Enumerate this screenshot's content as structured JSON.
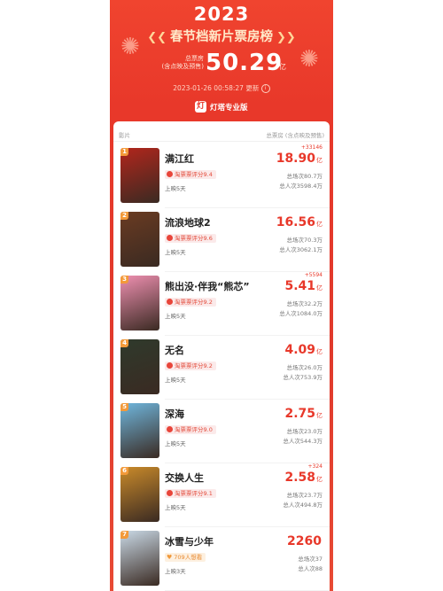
{
  "header": {
    "year": "2023",
    "title": "春节档新片票房榜",
    "total_label_line1": "总票房",
    "total_label_line2": "(含点映及预售)",
    "total_value": "50.29",
    "total_unit": "亿",
    "update_time": "2023-01-26 00:58:27 更新",
    "brand": "灯塔专业版"
  },
  "table": {
    "col_film": "影片",
    "col_box": "总票房 (含点映及预售)"
  },
  "films": [
    {
      "rank": "1",
      "name": "满江红",
      "badge_type": "rating",
      "badge": "淘票票评分9.4",
      "days": "上映5天",
      "delta": "+33146",
      "box": "18.90",
      "unit": "亿",
      "sessions": "总场次80.7万",
      "people": "总人次3598.4万",
      "poster_color": "#b2261c"
    },
    {
      "rank": "2",
      "name": "流浪地球2",
      "badge_type": "rating",
      "badge": "淘票票评分9.6",
      "days": "上映5天",
      "delta": "",
      "box": "16.56",
      "unit": "亿",
      "sessions": "总场次70.3万",
      "people": "总人次3062.1万",
      "poster_color": "#6a3b22"
    },
    {
      "rank": "3",
      "name": "熊出没·伴我“熊芯”",
      "badge_type": "rating",
      "badge": "淘票票评分9.2",
      "days": "上映5天",
      "delta": "+5594",
      "box": "5.41",
      "unit": "亿",
      "sessions": "总场次32.2万",
      "people": "总人次1084.0万",
      "poster_color": "#ee8fb0"
    },
    {
      "rank": "4",
      "name": "无名",
      "badge_type": "rating",
      "badge": "淘票票评分9.2",
      "days": "上映5天",
      "delta": "",
      "box": "4.09",
      "unit": "亿",
      "sessions": "总场次26.0万",
      "people": "总人次753.9万",
      "poster_color": "#2f3a2c"
    },
    {
      "rank": "5",
      "name": "深海",
      "badge_type": "rating",
      "badge": "淘票票评分9.0",
      "days": "上映5天",
      "delta": "",
      "box": "2.75",
      "unit": "亿",
      "sessions": "总场次23.0万",
      "people": "总人次544.3万",
      "poster_color": "#6fb6dd"
    },
    {
      "rank": "6",
      "name": "交换人生",
      "badge_type": "rating",
      "badge": "淘票票评分9.1",
      "days": "上映5天",
      "delta": "+324",
      "box": "2.58",
      "unit": "亿",
      "sessions": "总场次23.7万",
      "people": "总人次494.8万",
      "poster_color": "#c98a2a"
    },
    {
      "rank": "7",
      "name": "冰雪与少年",
      "badge_type": "want",
      "badge": "709人想看",
      "days": "上映3天",
      "delta": "",
      "box": "2260",
      "unit": "",
      "sessions": "总场次37",
      "people": "总人次88",
      "poster_color": "#c9d9e6"
    }
  ],
  "colors": {
    "accent": "#e8382a",
    "rank_badge": "#f39a3a"
  }
}
